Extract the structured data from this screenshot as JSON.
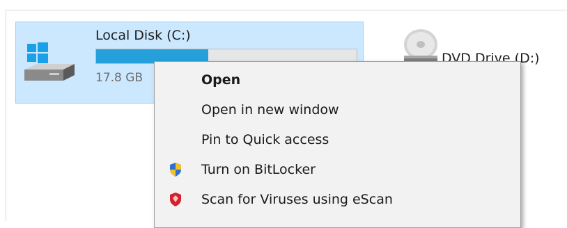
{
  "drives": {
    "c": {
      "name": "Local Disk (C:)",
      "free_text": "17.8 GB",
      "used_fraction": 0.43,
      "bar_color": "#26a0da",
      "icon": "hard-drive-icon"
    },
    "d": {
      "name": "DVD Drive (D:)",
      "icon": "dvd-drive-icon"
    }
  },
  "context_menu": {
    "items": [
      {
        "label": "Open",
        "bold": true
      },
      {
        "label": "Open in new window"
      },
      {
        "label": "Pin to Quick access"
      },
      {
        "label": "Turn on BitLocker",
        "icon": "shield-icon"
      },
      {
        "label": "Scan for Viruses using eScan",
        "icon": "escan-shield-icon"
      }
    ]
  },
  "colors": {
    "selection_bg": "#cce8ff",
    "selection_border": "#99d1ff",
    "menu_bg": "#f2f2f2"
  }
}
